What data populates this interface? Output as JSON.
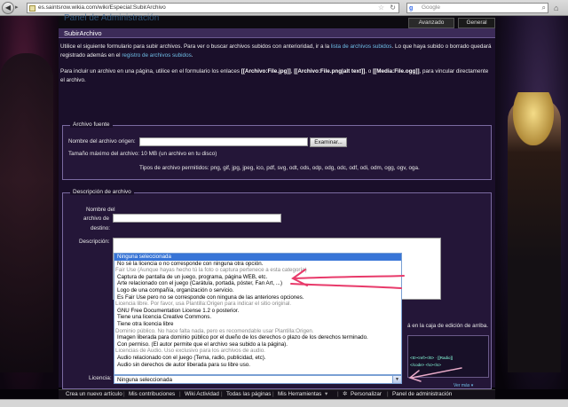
{
  "browser": {
    "back_icon": "back-arrow-icon",
    "forward_icon": "forward-arrow-icon",
    "url": "es.saintsrow.wikia.com/wiki/Especial:SubirArchivo",
    "search_engine_icon": "google-icon",
    "search_placeholder": "Google",
    "home_icon": "home-icon"
  },
  "wiki": {
    "header_title": "Panel de Administración",
    "tabs": [
      {
        "label": "Avanzado"
      },
      {
        "label": "General"
      }
    ]
  },
  "page": {
    "heading": "SubirArchivo",
    "intro_p1_a": "Utilice el siguiente formulario para subir archivos. Para ver o buscar archivos subidos con anterioridad, ir a la ",
    "intro_p1_link1": "lista de archivos subidos",
    "intro_p1_b": ". Lo que haya subido o borrado quedará registrado además en el ",
    "intro_p1_link2": "registro de archivos subidos",
    "intro_p1_c": ".",
    "intro_p2_a": "Para incluir un archivo en una página, utilice en el formulario los enlaces ",
    "intro_p2_code1": "[[Archivo:File.jpg]]",
    "intro_p2_sep1": ", ",
    "intro_p2_code2": "[[Archivo:File.png|alt text]]",
    "intro_p2_sep2": ", o ",
    "intro_p2_code3": "[[Media:File.ogg]]",
    "intro_p2_b": ", para vincular directamente el archivo."
  },
  "source": {
    "legend": "Archivo fuente",
    "origin_label": "Nombre del archivo origen:",
    "browse_button": "Examinar...",
    "max_size": "Tamaño máximo del archivo: 10 MB (un archivo en tu disco)",
    "allowed_types": "Tipos de archivo permitidos: png, gif, jpg, jpeg, ico, pdf, svg, odt, ods, odp, odg, odc, odf, odi, odm, ogg, ogv, oga."
  },
  "description": {
    "legend": "Descripción de archivo",
    "dest_label_1": "Nombre del",
    "dest_label_2": "archivo de",
    "dest_label_3": "destino:",
    "desc_label": "Descripción:",
    "right_note": "á en la caja de edición de arriba.",
    "preview_code": "<tt><ref></tt> · [[Radio]]",
    "preview_code2": "</code> <\\s><\\s>",
    "preview_link": "Ver más ▾"
  },
  "license": {
    "label": "Licencia:",
    "selected": "Ninguna seleccionada",
    "options": [
      {
        "text": "Ninguna seleccionada",
        "kind": "selected"
      },
      {
        "text": "No sé la licencia o no corresponde con ninguna otra opción.",
        "kind": "option"
      },
      {
        "text": "Fair Use (Aunque hayas hecho tú la foto o captura pertenece a esta categoría)",
        "kind": "group"
      },
      {
        "text": "Captura de pantalla de un juego, programa, página WEB, etc.",
        "kind": "option"
      },
      {
        "text": "Arte relacionado con el juego (Carátula, portada, póster, Fan Art, ...)",
        "kind": "option"
      },
      {
        "text": "Logo de una compañía, organización o servicio.",
        "kind": "option"
      },
      {
        "text": "Es Fair Use pero no se corresponde con ninguna de las anteriores opciones.",
        "kind": "option"
      },
      {
        "text": "Licencia libre. Por favor, usa Plantilla:Origen para indicar el sitio original.",
        "kind": "group"
      },
      {
        "text": "GNU Free Documentation License 1.2 o posterior.",
        "kind": "option"
      },
      {
        "text": "Tiene una licencia Creative Commons.",
        "kind": "option"
      },
      {
        "text": "Tiene otra licencia libre",
        "kind": "option"
      },
      {
        "text": "Dominio público. No hace falta nada, pero es recomendable usar Plantilla:Origen.",
        "kind": "group"
      },
      {
        "text": "Imagen liberada para dominio público por el dueño de los derechos o plazo de los derechos terminado.",
        "kind": "option"
      },
      {
        "text": "Con permiso. (El autor permite que el archivo sea subido a la página).",
        "kind": "option"
      },
      {
        "text": "Licencias de Audio. Uso exclusivo para los archivos de audio.",
        "kind": "group"
      },
      {
        "text": "Audio relacionado con el juego (Tema, radio, publicidad, etc).",
        "kind": "option"
      },
      {
        "text": "Audio sin derechos de autor liberada para su libre uso.",
        "kind": "option"
      }
    ]
  },
  "toolbar": {
    "items": [
      {
        "label": "Crea un nuevo artículo"
      },
      {
        "label": "Mis contribuciones"
      },
      {
        "label": "Wiki Actividad"
      },
      {
        "label": "Todas las páginas"
      },
      {
        "label": "Mis Herramientas"
      },
      {
        "label": "Personalizar"
      },
      {
        "label": "Panel de administración"
      }
    ],
    "settings_icon": "gear-icon"
  },
  "colors": {
    "accent_link": "#6fbfe8",
    "panel_bg": "#241638",
    "heading_bar": "#3c2b58",
    "annotation_pink": "#e83a6a",
    "select_highlight": "#3875d7"
  }
}
